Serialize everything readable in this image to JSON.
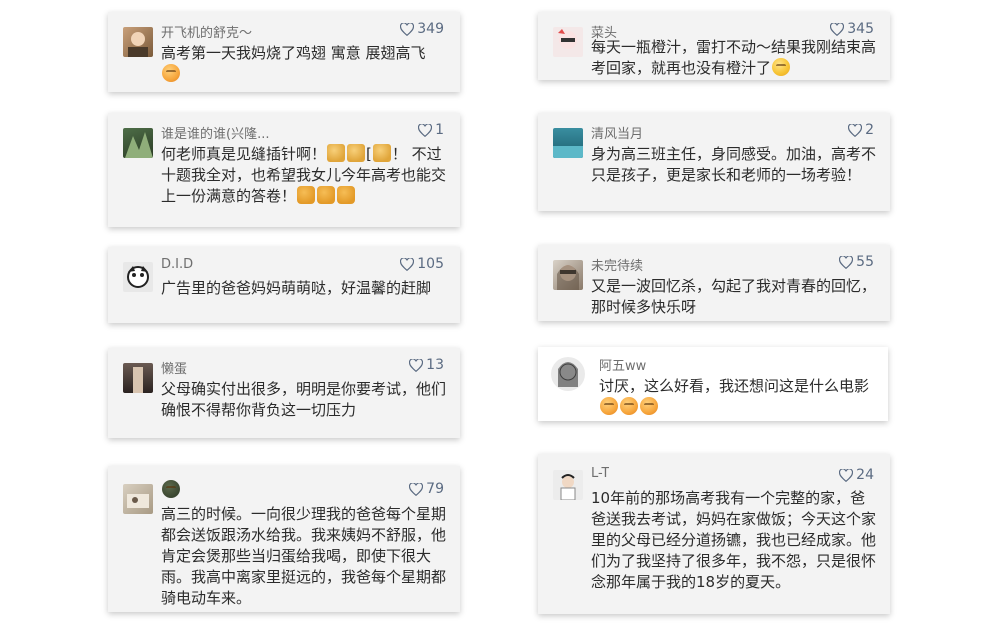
{
  "comments": [
    {
      "user": "开飞机的舒克～",
      "likes": "349",
      "text": "高考第一天我妈烧了鸡翅 寓意 展翅高飞",
      "emoji": [
        "crying-laugh-emoji"
      ]
    },
    {
      "user": "菜头",
      "likes": "345",
      "text": "每天一瓶橙汁，雷打不动～结果我刚结束高考回家，就再也没有橙汁了",
      "emoji": [
        "crying-emoji"
      ]
    },
    {
      "user": "谁是谁的谁(兴隆...",
      "likes": "1",
      "text_a": "何老师真是见缝插针啊！",
      "text_b": "[",
      "text_c": "！ 不过十题我全对，也希望我女儿今年高考也能交上一份满意的答卷！",
      "emoji": [
        "thumbs-up-emoji",
        "thumbs-up-emoji",
        "thumbs-up-emoji",
        "fist-emoji",
        "fist-emoji",
        "fist-emoji"
      ]
    },
    {
      "user": "清风当月",
      "likes": "2",
      "text": "身为高三班主任，身同感受。加油，高考不只是孩子，更是家长和老师的一场考验！"
    },
    {
      "user": "D.I.D",
      "likes": "105",
      "text": "广告里的爸爸妈妈萌萌哒，好温馨的赶脚"
    },
    {
      "user": "未完待续",
      "likes": "55",
      "text": "又是一波回忆杀，勾起了我对青春的回忆，那时候多快乐呀"
    },
    {
      "user": "懒蛋",
      "likes": "13",
      "text": "父母确实付出很多，明明是你要考试，他们确恨不得帮你背负这一切压力"
    },
    {
      "user": "阿五ww",
      "likes": "",
      "text": "讨厌，这么好看，我还想问这是什么电影",
      "emoji": [
        "yum-emoji",
        "yum-emoji",
        "yum-emoji"
      ]
    },
    {
      "user": "",
      "likes": "79",
      "text": "高三的时候。一向很少理我的爸爸每个星期都会送饭跟汤水给我。我来姨妈不舒服，他肯定会煲那些当归蛋给我喝，即使下很大雨。我高中离家里挺远的，我爸每个星期都骑电动车来。",
      "emoji": [
        "face-emoji"
      ]
    },
    {
      "user": "L-T",
      "likes": "24",
      "text": "10年前的那场高考我有一个完整的家，爸爸送我去考试，妈妈在家做饭；今天这个家里的父母已经分道扬镳，我也已经成家。他们为了我坚持了很多年，我不怨，只是很怀念那年属于我的18岁的夏天。"
    }
  ],
  "colors": {
    "card_bg": "#f3f3f3",
    "like_color": "#5b6b82",
    "name_color": "#6e6e6e",
    "text_color": "#2b2b2b"
  }
}
